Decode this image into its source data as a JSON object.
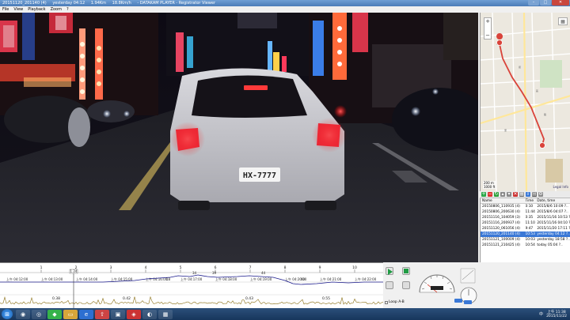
{
  "window": {
    "title_file": "20151120_201140 (4)",
    "title_date": "yesterday 04:12",
    "title_dist": "1.94Km",
    "title_speed": "18.8Km/h",
    "title_app": "- DATAKAM PLAYER - Registrator Viewer"
  },
  "menu": [
    "File",
    "View",
    "Playback",
    "Zoom",
    "?"
  ],
  "video": {
    "plate": "HX-7777"
  },
  "map": {
    "zoom_in": "+",
    "zoom_out": "−",
    "scale_m": "200 m",
    "scale_ft": "1000 ft",
    "credit": "Legal Info"
  },
  "filelist": {
    "headers": [
      "Name",
      "Time",
      "Date, time"
    ],
    "rows": [
      {
        "name": "20150806_110935 (4)",
        "time": "0:10",
        "date": "2015/8/6 10:09 ?.."
      },
      {
        "name": "20150806_200630 (4)",
        "time": "11:44",
        "date": "2015/8/6 04:07 ?.."
      },
      {
        "name": "20151116_104059 (3)",
        "time": "0:35",
        "date": "2015/11/16 10:53 ?.."
      },
      {
        "name": "20151116_200937 (4)",
        "time": "11:10",
        "date": "2015/11/16 04:10 ?.."
      },
      {
        "name": "20151120_061056 (4)",
        "time": "9:47",
        "date": "2015/11/20 17:11 ?.."
      },
      {
        "name": "20151120_201140 (4)",
        "time": "10:53",
        "date": "yesterday 04:12 ?.."
      },
      {
        "name": "20151121_100009 (4)",
        "time": "10:03",
        "date": "yesterday 18:58 ?.."
      },
      {
        "name": "20151121_210425 (4)",
        "time": "10:54",
        "date": "today 05:04 ?.."
      }
    ],
    "selected_index": 5
  },
  "timeline": {
    "minute_ticks": [
      "1",
      "2",
      "3",
      "4",
      "5",
      "6",
      "7",
      "8",
      "9",
      "10"
    ],
    "timestamps": [
      "上午 04:12:00",
      "上午 04:13:00",
      "上午 04:14:00",
      "上午 04:15:00",
      "上午 04:16:00",
      "上午 04:17:00",
      "上午 04:18:00",
      "上午 04:19:00",
      "上午 04:20:00",
      "上午 04:21:00",
      "上午 04:22:00"
    ],
    "value_labels": [
      "0.38",
      "0.42",
      "0.43",
      "0.55"
    ],
    "speed_labels": [
      "18",
      "34",
      "39",
      "44",
      "60"
    ],
    "cursor_label": "1.24"
  },
  "controls": {
    "loop_label": "Loop A-B"
  },
  "taskbar": {
    "lang": "中",
    "time": "上午 11:38",
    "date": "2015/11/22"
  },
  "colors": {
    "accent": "#3a78d6",
    "play": "#1f9b43",
    "route": "#d9433a",
    "speed_line": "#1a1a8c",
    "gsensor": "#8a6f16"
  }
}
